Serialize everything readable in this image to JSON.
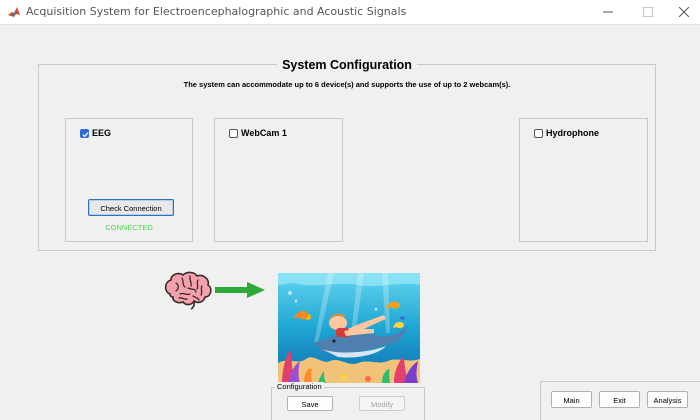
{
  "window": {
    "title": "Acquisition System for Electroencephalographic and Acoustic Signals"
  },
  "system_config": {
    "title": "System Configuration",
    "description": "The system can accommodate up to 6 device(s) and supports the use of up to 2 webcam(s)."
  },
  "devices": [
    {
      "label": "EEG",
      "checked": true,
      "button_label": "Check Connection",
      "status": "CONNECTED",
      "status_color": "#4cd94c"
    },
    {
      "label": "WebCam 1",
      "checked": false
    },
    {
      "label": "Hydrophone",
      "checked": false
    }
  ],
  "illustration": {
    "brain_icon": "brain-icon",
    "arrow_icon": "arrow-right-icon",
    "scene": "underwater-boy-dolphin-image",
    "arrow_color": "#2fa83a"
  },
  "config_panel": {
    "label": "Configuration",
    "save_label": "Save",
    "modify_label": "Modify"
  },
  "nav": {
    "main_label": "Main",
    "exit_label": "Exit",
    "analysis_label": "Analysis"
  },
  "colors": {
    "accent": "#2e6bd6",
    "background": "#f0f0f0"
  }
}
